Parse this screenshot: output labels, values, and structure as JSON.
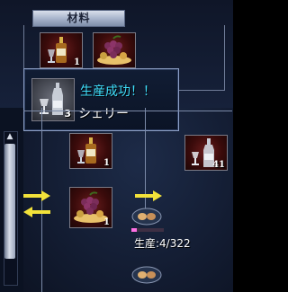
{
  "materials_header": "材料",
  "materials": [
    {
      "icon": "whiskey-bottle-icon",
      "count": "1"
    },
    {
      "icon": "grapes-icon",
      "count": ""
    }
  ],
  "tooltip": {
    "title": "生産成功！！",
    "item_name": "シェリー",
    "count": "3",
    "icon": "sherry-bottle-icon"
  },
  "queue": [
    {
      "icon": "whiskey-bottle-icon",
      "count": "1"
    },
    {
      "icon": "grapes-icon",
      "count": "1"
    },
    {
      "icon": "wine-bottle-icon",
      "count": "41"
    }
  ],
  "production": {
    "label": "生産:4/322",
    "current": 4,
    "total": 322
  },
  "colors": {
    "accent": "#40e0ff",
    "progress": "#ff70e4",
    "arrow": "#f2e23a"
  }
}
